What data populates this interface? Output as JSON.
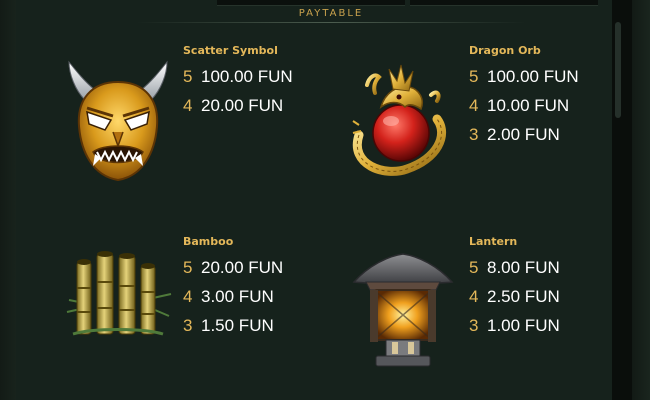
{
  "header": {
    "title": "PAYTABLE"
  },
  "colors": {
    "accent": "#e4b85a",
    "background": "#16221c",
    "text": "#ffffff"
  },
  "symbols": [
    {
      "name": "Scatter Symbol",
      "icon": "oni-mask-icon",
      "pays": [
        {
          "count": "5",
          "value": "100.00 FUN"
        },
        {
          "count": "4",
          "value": "20.00 FUN"
        }
      ]
    },
    {
      "name": "Dragon Orb",
      "icon": "dragon-orb-icon",
      "pays": [
        {
          "count": "5",
          "value": "100.00 FUN"
        },
        {
          "count": "4",
          "value": "10.00 FUN"
        },
        {
          "count": "3",
          "value": "2.00 FUN"
        }
      ]
    },
    {
      "name": "Bamboo",
      "icon": "bamboo-icon",
      "pays": [
        {
          "count": "5",
          "value": "20.00 FUN"
        },
        {
          "count": "4",
          "value": "3.00 FUN"
        },
        {
          "count": "3",
          "value": "1.50 FUN"
        }
      ]
    },
    {
      "name": "Lantern",
      "icon": "lantern-icon",
      "pays": [
        {
          "count": "5",
          "value": "8.00 FUN"
        },
        {
          "count": "4",
          "value": "2.50 FUN"
        },
        {
          "count": "3",
          "value": "1.00 FUN"
        }
      ]
    }
  ]
}
